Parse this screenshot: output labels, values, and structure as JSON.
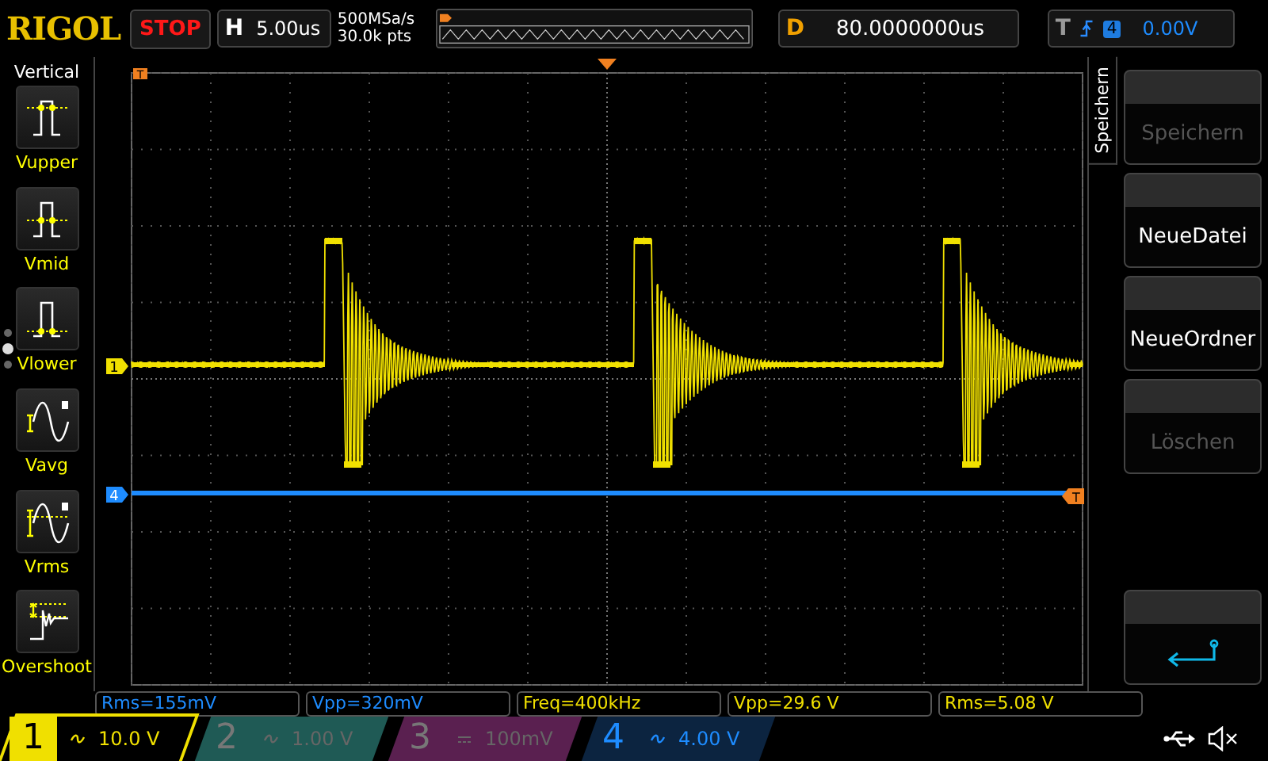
{
  "header": {
    "logo": "RIGOL",
    "run_state": "STOP",
    "horizontal": {
      "label": "H",
      "timebase": "5.00us"
    },
    "sample_rate": "500MSa/s",
    "memory_depth": "30.0k pts",
    "delay": {
      "label": "D",
      "value": "80.0000000us"
    },
    "trigger": {
      "label": "T",
      "source": "4",
      "level": "0.00V"
    }
  },
  "left_menu": {
    "title": "Vertical",
    "items": [
      {
        "label": "Vupper",
        "kind": "upper"
      },
      {
        "label": "Vmid",
        "kind": "mid"
      },
      {
        "label": "Vlower",
        "kind": "lower"
      },
      {
        "label": "Vavg",
        "kind": "avg"
      },
      {
        "label": "Vrms",
        "kind": "rms"
      },
      {
        "label": "Overshoot",
        "kind": "overshoot"
      }
    ]
  },
  "display": {
    "trigger_time_marker": "T",
    "trigger_level_marker": "T",
    "channel_markers": [
      {
        "label": "1",
        "color": "#f0e000"
      },
      {
        "label": "4",
        "color": "#1e8cff"
      }
    ]
  },
  "right_menu": {
    "title": "Speichern",
    "buttons": [
      {
        "label": "Speichern",
        "kind": "text",
        "disabled": true
      },
      {
        "label": "NeueDatei",
        "kind": "text",
        "disabled": false
      },
      {
        "label": "NeueOrdner",
        "kind": "text",
        "disabled": false
      },
      {
        "label": "Löschen",
        "kind": "text",
        "disabled": true
      },
      {
        "kind": "back",
        "disabled": false
      }
    ]
  },
  "measurements": [
    {
      "text": "Rms=155mV",
      "color": "#1e8cff"
    },
    {
      "text": "Vpp=320mV",
      "color": "#1e8cff"
    },
    {
      "text": "Freq=400kHz",
      "color": "#f0e000"
    },
    {
      "text": "Vpp=29.6 V",
      "color": "#f0e000"
    },
    {
      "text": "Rms=5.08 V",
      "color": "#f0e000"
    }
  ],
  "channels": [
    {
      "number": "1",
      "kind": "ac",
      "scale": "10.0 V",
      "color": "#f0e000",
      "on": true,
      "selected": true
    },
    {
      "number": "2",
      "kind": "ac",
      "scale": "1.00 V",
      "color": "#1f5a55",
      "on": false,
      "selected": false
    },
    {
      "number": "3",
      "kind": "dc",
      "scale": "100mV",
      "color": "#5a2050",
      "on": false,
      "selected": false
    },
    {
      "number": "4",
      "kind": "ac",
      "scale": "4.00 V",
      "color": "#1e8cff",
      "on": true,
      "selected": false
    }
  ],
  "status": {
    "muted": true
  }
}
